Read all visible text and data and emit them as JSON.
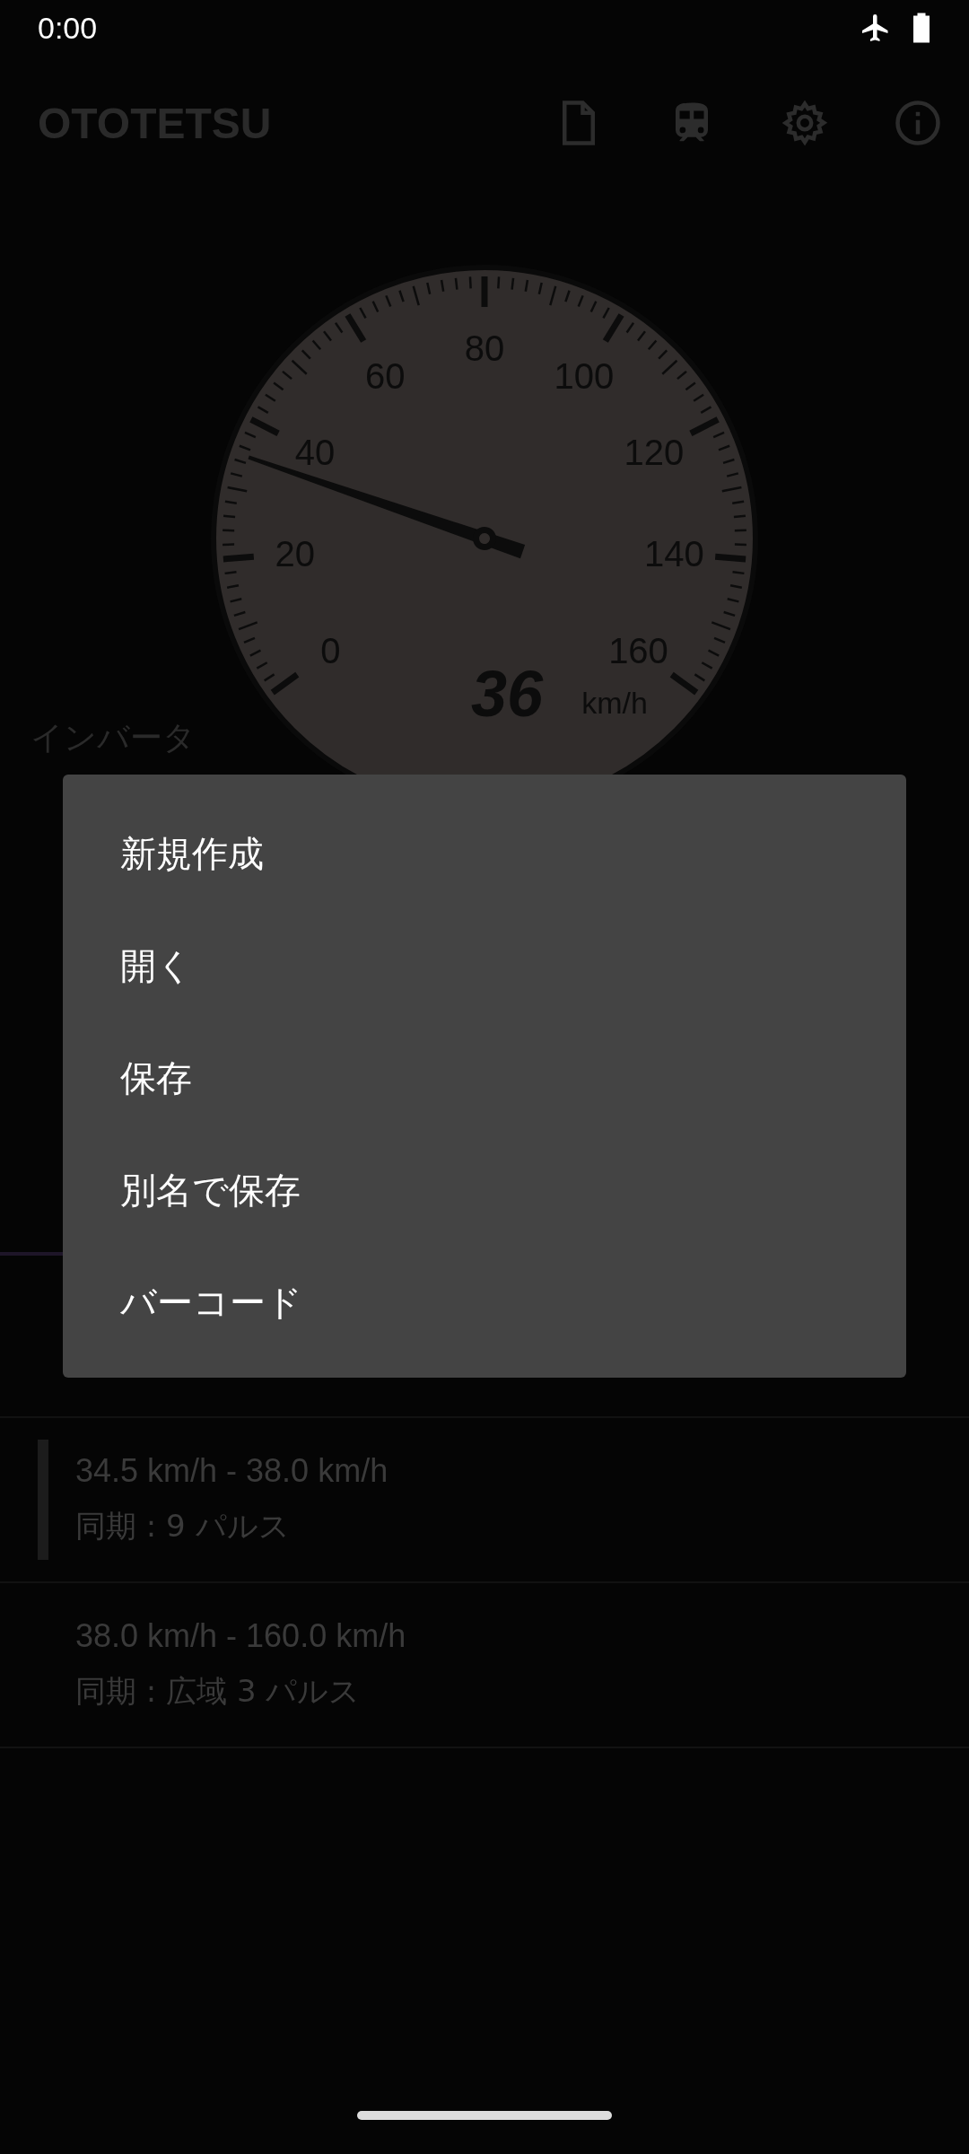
{
  "status_bar": {
    "time": "0:00"
  },
  "app_bar": {
    "title": "OTOTETSU"
  },
  "speedometer": {
    "ticks": [
      "0",
      "20",
      "40",
      "60",
      "80",
      "100",
      "120",
      "140",
      "160"
    ],
    "speed": "36",
    "unit": "km/h"
  },
  "section_label": "インバータ",
  "list": [
    {
      "range": "34.5 km/h - 38.0 km/h",
      "mode": "同期 : 9 パルス",
      "selected": true
    },
    {
      "range": "38.0 km/h - 160.0 km/h",
      "mode": "同期 : 広域 3 パルス",
      "selected": false
    }
  ],
  "menu": {
    "items": [
      "新規作成",
      "開く",
      "保存",
      "別名で保存",
      "バーコード"
    ]
  }
}
